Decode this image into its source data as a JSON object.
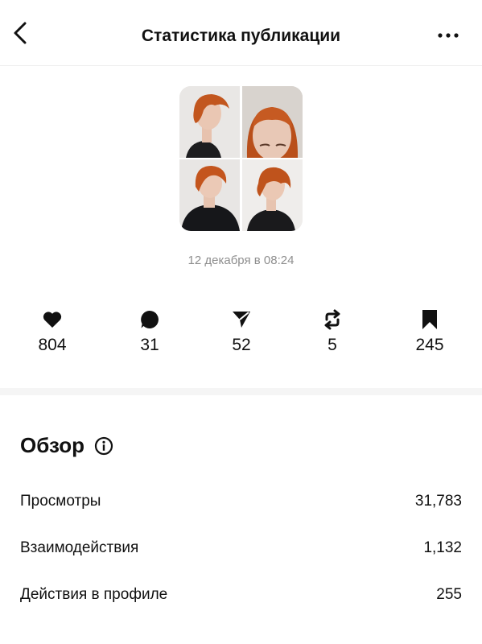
{
  "header": {
    "title": "Статистика публикации",
    "back_icon": "chevron-left-icon",
    "more_icon": "more-horizontal-icon"
  },
  "post": {
    "date": "12 декабря в 08:24",
    "thumbnail": "photo-collage-2x2"
  },
  "stats": [
    {
      "icon": "heart-icon",
      "value": "804"
    },
    {
      "icon": "comment-icon",
      "value": "31"
    },
    {
      "icon": "share-icon",
      "value": "52"
    },
    {
      "icon": "repost-icon",
      "value": "5"
    },
    {
      "icon": "bookmark-icon",
      "value": "245"
    }
  ],
  "overview": {
    "title": "Обзор",
    "info_icon": "info-icon",
    "rows": [
      {
        "label": "Просмотры",
        "value": "31,783"
      },
      {
        "label": "Взаимодействия",
        "value": "1,132"
      },
      {
        "label": "Действия в профиле",
        "value": "255"
      }
    ]
  }
}
